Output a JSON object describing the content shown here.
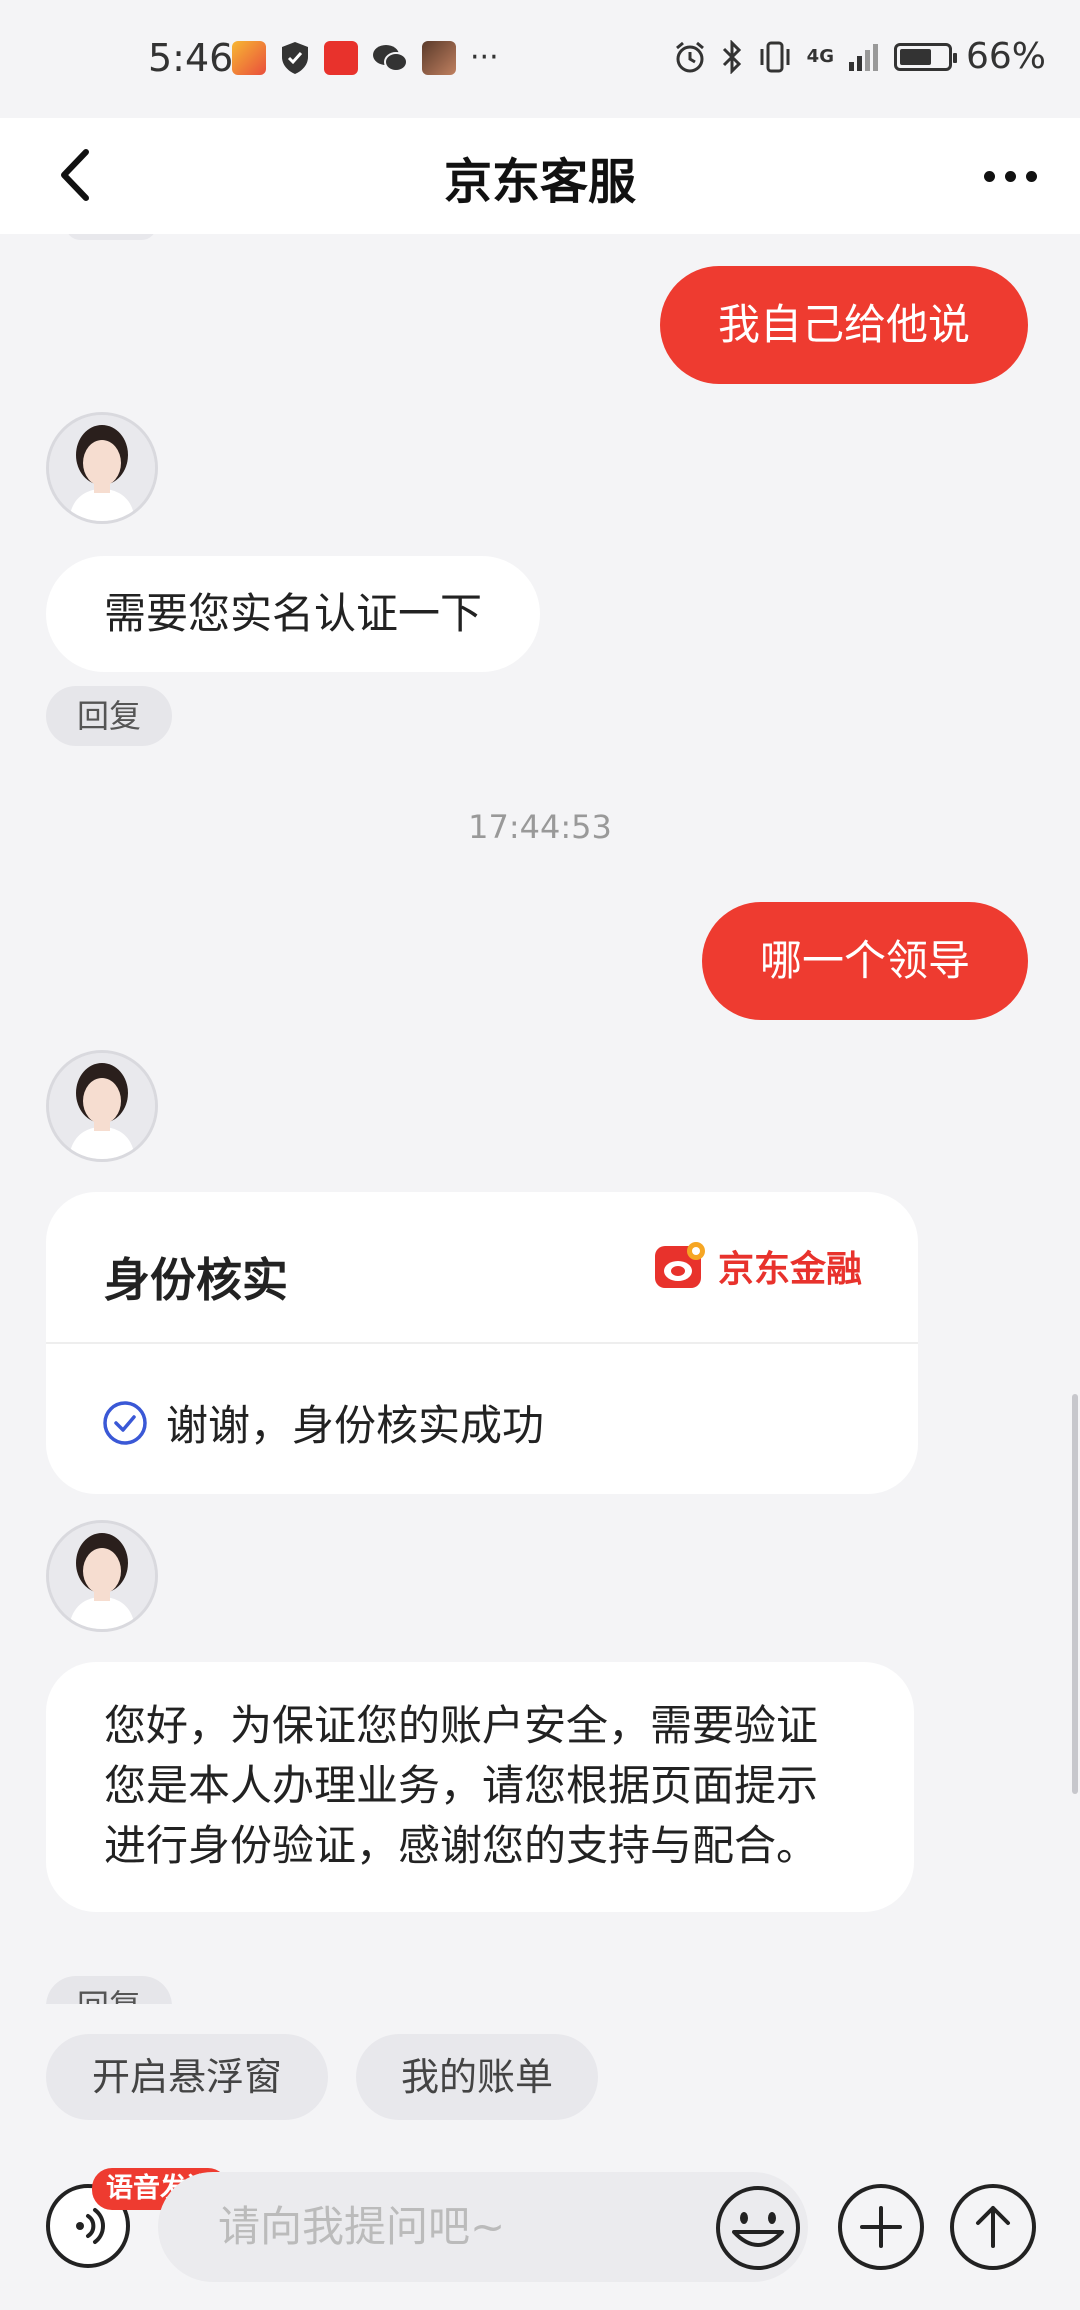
{
  "status_bar": {
    "time": "5:46",
    "left_icons": [
      "618-app-icon",
      "shield-check-icon",
      "618-promo-icon",
      "wechat-icon",
      "photo-thumbnail-icon",
      "more-dots"
    ],
    "overflow": "···",
    "network": "4G",
    "battery": "66%",
    "battery_level": 0.66
  },
  "header": {
    "title": "京东客服"
  },
  "messages": {
    "m1_out": "我自己给他说",
    "m2_in": "需要您实名认证一下",
    "reply_label": "回复",
    "timestamp": "17:44:53",
    "m3_out": "哪一个领导",
    "card": {
      "title": "身份核实",
      "brand": "京东金融",
      "status": "谢谢，身份核实成功"
    },
    "m4_in": "您好，为保证您的账户安全，需要验证您是本人办理业务，请您根据页面提示进行身份验证，感谢您的支持与配合。",
    "reply_label_2": "回复"
  },
  "quick_actions": [
    "开启悬浮窗",
    "我的账单"
  ],
  "input": {
    "voice_badge": "语音发送",
    "placeholder": "请向我提问吧~"
  },
  "colors": {
    "accent": "#ee3b30",
    "background": "#f4f4f6",
    "check": "#3a58d6"
  }
}
